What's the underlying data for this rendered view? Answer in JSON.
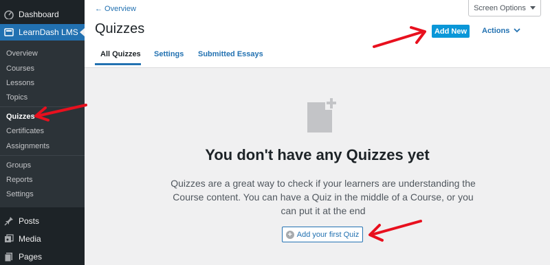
{
  "sidebar": {
    "dashboard": "Dashboard",
    "learndash": "LearnDash LMS",
    "submenu": [
      "Overview",
      "Courses",
      "Lessons",
      "Topics",
      "Quizzes",
      "Certificates",
      "Assignments",
      "Groups",
      "Reports",
      "Settings"
    ],
    "posts": "Posts",
    "media": "Media",
    "pages": "Pages"
  },
  "header": {
    "breadcrumb": "← Overview",
    "screen_options": "Screen Options",
    "title": "Quizzes",
    "add_new": "Add New",
    "actions": "Actions"
  },
  "tabs": [
    "All Quizzes",
    "Settings",
    "Submitted Essays"
  ],
  "empty_state": {
    "title": "You don't have any Quizzes yet",
    "description": "Quizzes are a great way to check if your learners are understanding the Course content. You can have a Quiz in the middle of a Course, or you can put it at the end",
    "button": "Add your first Quiz"
  },
  "colors": {
    "accent": "#2271b1",
    "add_new_bg": "#0a97d8",
    "annotation": "#e8101e"
  }
}
